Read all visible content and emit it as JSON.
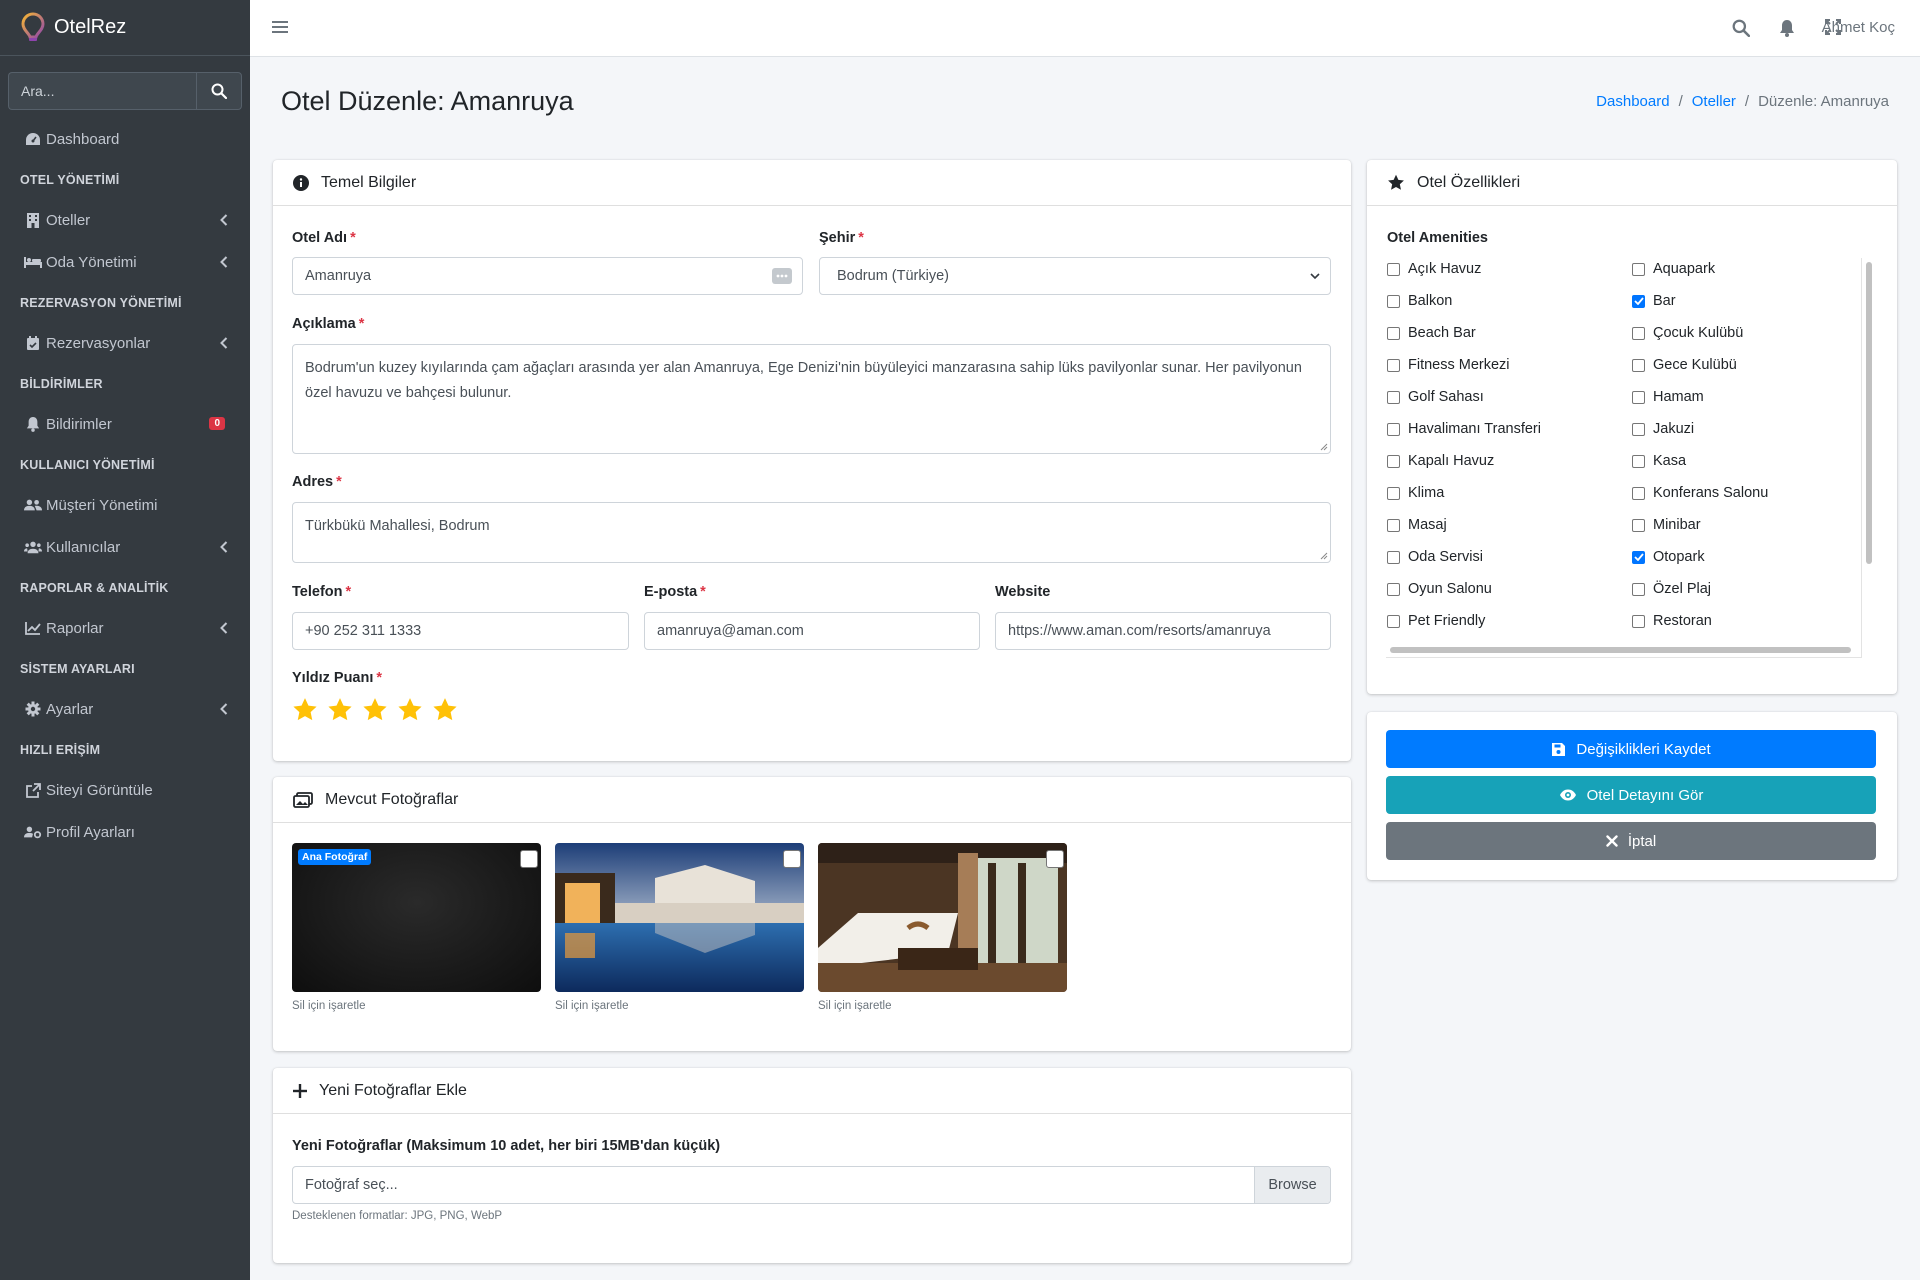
{
  "app": {
    "name": "OtelRez",
    "user": "Ahmet Koç"
  },
  "sidebar": {
    "search_placeholder": "Ara...",
    "nav": [
      {
        "type": "item",
        "label": "Dashboard",
        "icon": "dashboard-icon"
      },
      {
        "type": "header",
        "label": "OTEL YÖNETİMİ"
      },
      {
        "type": "item",
        "label": "Oteller",
        "icon": "hotel-icon",
        "chevron": true
      },
      {
        "type": "item",
        "label": "Oda Yönetimi",
        "icon": "bed-icon",
        "chevron": true
      },
      {
        "type": "header",
        "label": "REZERVASYON YÖNETİMİ"
      },
      {
        "type": "item",
        "label": "Rezervasyonlar",
        "icon": "calendar-check-icon",
        "chevron": true
      },
      {
        "type": "header",
        "label": "BİLDİRİMLER"
      },
      {
        "type": "item",
        "label": "Bildirimler",
        "icon": "bell-icon",
        "badge": "0"
      },
      {
        "type": "header",
        "label": "KULLANICI YÖNETİMİ"
      },
      {
        "type": "item",
        "label": "Müşteri Yönetimi",
        "icon": "user-friends-icon"
      },
      {
        "type": "item",
        "label": "Kullanıcılar",
        "icon": "users-icon",
        "chevron": true
      },
      {
        "type": "header",
        "label": "RAPORLAR & ANALİTİK"
      },
      {
        "type": "item",
        "label": "Raporlar",
        "icon": "chart-line-icon",
        "chevron": true
      },
      {
        "type": "header",
        "label": "SİSTEM AYARLARI"
      },
      {
        "type": "item",
        "label": "Ayarlar",
        "icon": "cog-icon",
        "chevron": true
      },
      {
        "type": "header",
        "label": "HIZLI ERİŞİM"
      },
      {
        "type": "item",
        "label": "Siteyi Görüntüle",
        "icon": "external-link-icon"
      },
      {
        "type": "item",
        "label": "Profil Ayarları",
        "icon": "user-cog-icon"
      }
    ]
  },
  "page": {
    "title": "Otel Düzenle: Amanruya",
    "breadcrumb": [
      {
        "label": "Dashboard",
        "link": true
      },
      {
        "label": "Oteller",
        "link": true
      },
      {
        "label": "Düzenle: Amanruya",
        "link": false
      }
    ]
  },
  "basic": {
    "header": "Temel Bilgiler",
    "name_label": "Otel Adı",
    "name_value": "Amanruya",
    "city_label": "Şehir",
    "city_value": "Bodrum (Türkiye)",
    "desc_label": "Açıklama",
    "desc_value": "Bodrum'un kuzey kıyılarında çam ağaçları arasında yer alan Amanruya, Ege Denizi'nin büyüleyici manzarasına sahip lüks pavilyonlar sunar. Her pavilyonun özel havuzu ve bahçesi bulunur.",
    "address_label": "Adres",
    "address_value": "Türkbükü Mahallesi, Bodrum",
    "phone_label": "Telefon",
    "phone_value": "+90 252 311 1333",
    "email_label": "E-posta",
    "email_value": "amanruya@aman.com",
    "website_label": "Website",
    "website_value": "https://www.aman.com/resorts/amanruya",
    "stars_label": "Yıldız Puanı",
    "stars": 5,
    "star_color": "#ffc107"
  },
  "photos": {
    "header": "Mevcut Fotoğraflar",
    "main_badge": "Ana Fotoğraf",
    "caption": "Sil için işaretle"
  },
  "newphotos": {
    "header": "Yeni Fotoğraflar Ekle",
    "label": "Yeni Fotoğraflar (Maksimum 10 adet, her biri 15MB'dan küçük)",
    "placeholder": "Fotoğraf seç...",
    "browse": "Browse",
    "hint": "Desteklenen formatlar: JPG, PNG, WebP"
  },
  "features": {
    "header": "Otel Özellikleri",
    "title": "Otel Amenities",
    "left": [
      {
        "label": "Açık Havuz",
        "checked": false
      },
      {
        "label": "Balkon",
        "checked": false
      },
      {
        "label": "Beach Bar",
        "checked": false
      },
      {
        "label": "Fitness Merkezi",
        "checked": false
      },
      {
        "label": "Golf Sahası",
        "checked": false
      },
      {
        "label": "Havalimanı Transferi",
        "checked": false
      },
      {
        "label": "Kapalı Havuz",
        "checked": false
      },
      {
        "label": "Klima",
        "checked": false
      },
      {
        "label": "Masaj",
        "checked": false
      },
      {
        "label": "Oda Servisi",
        "checked": false
      },
      {
        "label": "Oyun Salonu",
        "checked": false
      },
      {
        "label": "Pet Friendly",
        "checked": false
      }
    ],
    "right": [
      {
        "label": "Aquapark",
        "checked": false
      },
      {
        "label": "Bar",
        "checked": true
      },
      {
        "label": "Çocuk Kulübü",
        "checked": false
      },
      {
        "label": "Gece Kulübü",
        "checked": false
      },
      {
        "label": "Hamam",
        "checked": false
      },
      {
        "label": "Jakuzi",
        "checked": false
      },
      {
        "label": "Kasa",
        "checked": false
      },
      {
        "label": "Konferans Salonu",
        "checked": false
      },
      {
        "label": "Minibar",
        "checked": false
      },
      {
        "label": "Otopark",
        "checked": true
      },
      {
        "label": "Özel Plaj",
        "checked": false
      },
      {
        "label": "Restoran",
        "checked": false
      }
    ]
  },
  "actions": {
    "save": "Değişiklikleri Kaydet",
    "view": "Otel Detayını Gör",
    "cancel": "İptal",
    "save_color": "#007bff",
    "view_color": "#17a2b8",
    "cancel_color": "#6c757d"
  }
}
